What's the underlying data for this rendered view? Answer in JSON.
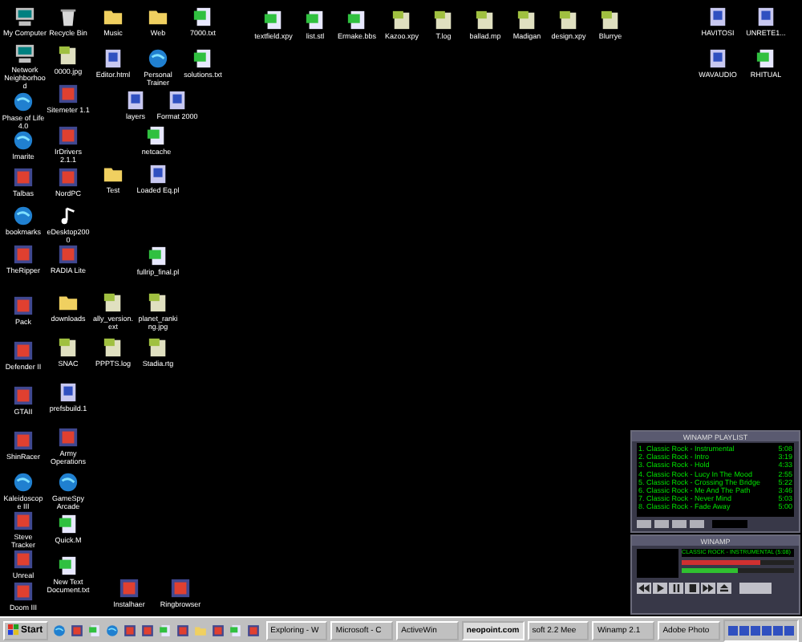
{
  "desktop": {
    "icons": [
      {
        "label": "My Computer",
        "kind": "computer"
      },
      {
        "label": "Network Neighborhood",
        "kind": "computer"
      },
      {
        "label": "Phase of Life 4.0",
        "kind": "globe"
      },
      {
        "label": "Imarite",
        "kind": "globe"
      },
      {
        "label": "Talbas",
        "kind": "app"
      },
      {
        "label": "bookmarks",
        "kind": "globe"
      },
      {
        "label": "TheRipper",
        "kind": "app"
      },
      {
        "label": "Pack",
        "kind": "app"
      },
      {
        "label": "Defender II",
        "kind": "app"
      },
      {
        "label": "GTAII",
        "kind": "app"
      },
      {
        "label": "ShinRacer",
        "kind": "app"
      },
      {
        "label": "Kaleidoscope III",
        "kind": "globe"
      },
      {
        "label": "Steve Tracker",
        "kind": "app"
      },
      {
        "label": "Unreal",
        "kind": "app"
      },
      {
        "label": "Doom III",
        "kind": "app"
      },
      {
        "label": "Recycle Bin",
        "kind": "recycle"
      },
      {
        "label": "0000.jpg",
        "kind": "image"
      },
      {
        "label": "Sitemeter 1.1",
        "kind": "app"
      },
      {
        "label": "IrDrivers 2.1.1",
        "kind": "app"
      },
      {
        "label": "NordPC",
        "kind": "app"
      },
      {
        "label": "eDesktop2000",
        "kind": "music"
      },
      {
        "label": "RADIA Lite",
        "kind": "app"
      },
      {
        "label": "downloads",
        "kind": "folder"
      },
      {
        "label": "SNAC",
        "kind": "image"
      },
      {
        "label": "prefsbuild.1",
        "kind": "text"
      },
      {
        "label": "Army Operations",
        "kind": "app"
      },
      {
        "label": "GameSpy Arcade",
        "kind": "globe"
      },
      {
        "label": "Quick.M",
        "kind": "doc"
      },
      {
        "label": "New Text Document.txt",
        "kind": "doc"
      },
      {
        "label": "Music",
        "kind": "folder"
      },
      {
        "label": "Editor.html",
        "kind": "text"
      },
      {
        "label": "Test",
        "kind": "folder"
      },
      {
        "label": "Web",
        "kind": "folder"
      },
      {
        "label": "Personal Trainer",
        "kind": "globe"
      },
      {
        "label": "7000.txt",
        "kind": "doc"
      },
      {
        "label": "solutions.txt",
        "kind": "doc"
      },
      {
        "label": "layers",
        "kind": "text"
      },
      {
        "label": "Format 2000",
        "kind": "text"
      },
      {
        "label": "netcache",
        "kind": "doc"
      },
      {
        "label": "Loaded Eq.pl",
        "kind": "text"
      },
      {
        "label": "fullrip_final.pl",
        "kind": "doc"
      },
      {
        "label": "ally_version.ext",
        "kind": "image"
      },
      {
        "label": "planet_ranking.jpg",
        "kind": "image"
      },
      {
        "label": "PPPTS.log",
        "kind": "image"
      },
      {
        "label": "Stadia.rtg",
        "kind": "image"
      },
      {
        "label": "Instalhaer",
        "kind": "app"
      },
      {
        "label": "Ringbrowser",
        "kind": "app"
      },
      {
        "label": "textfield.xpy",
        "kind": "doc"
      },
      {
        "label": "list.stl",
        "kind": "doc"
      },
      {
        "label": "Ermake.bbs",
        "kind": "doc"
      },
      {
        "label": "Kazoo.xpy",
        "kind": "image"
      },
      {
        "label": "T.log",
        "kind": "image"
      },
      {
        "label": "ballad.mp",
        "kind": "image"
      },
      {
        "label": "Madigan",
        "kind": "image"
      },
      {
        "label": "design.xpy",
        "kind": "image"
      },
      {
        "label": "Blurrye",
        "kind": "image"
      },
      {
        "label": "HAVITOSI",
        "kind": "text"
      },
      {
        "label": "UNRETE1...",
        "kind": "text"
      },
      {
        "label": "WAVAUDIO",
        "kind": "text"
      },
      {
        "label": "RHITUAL",
        "kind": "doc"
      }
    ]
  },
  "playlist": {
    "title": "WINAMP PLAYLIST",
    "tracks": [
      {
        "title": "1. Classic Rock - Instrumental",
        "time": "5:08"
      },
      {
        "title": "2. Classic Rock - Intro",
        "time": "3:19"
      },
      {
        "title": "3. Classic Rock - Hold",
        "time": "4:33"
      },
      {
        "title": "4. Classic Rock - Lucy In The Mood",
        "time": "2:55"
      },
      {
        "title": "5. Classic Rock - Crossing The Bridge",
        "time": "5:22"
      },
      {
        "title": "6. Classic Rock - Me And The Path",
        "time": "3:46"
      },
      {
        "title": "7. Classic Rock - Never Mind",
        "time": "5:03"
      },
      {
        "title": "8. Classic Rock - Fade Away",
        "time": "5:00"
      }
    ]
  },
  "player": {
    "title": "WINAMP",
    "song": "CLASSIC ROCK - INSTRUMENTAL (5:08)",
    "volume": {
      "level": 0.7
    },
    "balance": {
      "level": 0.5
    }
  },
  "taskbar": {
    "start": "Start",
    "quick_launch": [
      {
        "kind": "globe"
      },
      {
        "kind": "app"
      },
      {
        "kind": "doc"
      },
      {
        "kind": "globe"
      },
      {
        "kind": "app"
      },
      {
        "kind": "app"
      },
      {
        "kind": "doc"
      },
      {
        "kind": "app"
      },
      {
        "kind": "folder"
      },
      {
        "kind": "app"
      },
      {
        "kind": "doc"
      },
      {
        "kind": "app"
      }
    ],
    "tasks": [
      {
        "label": "Exploring - W",
        "selected": false
      },
      {
        "label": "Microsoft - C",
        "selected": false
      },
      {
        "label": "ActiveWin",
        "selected": false
      },
      {
        "label": "neopoint.com",
        "selected": true
      },
      {
        "label": "soft 2.2 Mee",
        "selected": false
      },
      {
        "label": "Winamp 2.1",
        "selected": false
      },
      {
        "label": "Adobe Photo",
        "selected": false
      }
    ]
  }
}
